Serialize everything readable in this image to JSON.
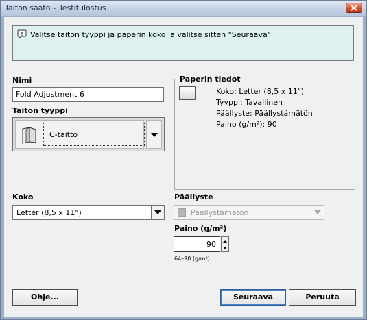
{
  "window": {
    "title": "Taiton säätö – Testitulostus"
  },
  "info": {
    "message": "Valitse taiton tyyppi ja paperin koko ja valitse sitten \"Seuraava\"."
  },
  "name_field": {
    "label": "Nimi",
    "value": "Fold Adjustment 6"
  },
  "fold_type": {
    "label": "Taiton tyyppi",
    "value": "C-taitto"
  },
  "paper_info": {
    "title": "Paperin tiedot",
    "lines": [
      "Koko: Letter (8,5 x 11\")",
      "Tyyppi: Tavallinen",
      "Päällyste: Päällystämätön",
      "Paino (g/m²): 90"
    ]
  },
  "size": {
    "label": "Koko",
    "value": "Letter (8,5 x 11\")"
  },
  "coating": {
    "label": "Päällyste",
    "value": "Päällystämätön"
  },
  "weight": {
    "label": "Paino (g/m²)",
    "value": "90",
    "range": "64–90 (g/m²)"
  },
  "buttons": {
    "help": "Ohje...",
    "next": "Seuraava",
    "cancel": "Peruuta"
  },
  "icons": {
    "info": "speech-bubble-icon",
    "fold": "c-fold-icon",
    "paper": "paper-sheet-icon",
    "close": "close-icon"
  },
  "colors": {
    "info_bg": "#ddf1ef",
    "close_btn": "#d4512f",
    "titlebar": "#c3d2e5"
  }
}
